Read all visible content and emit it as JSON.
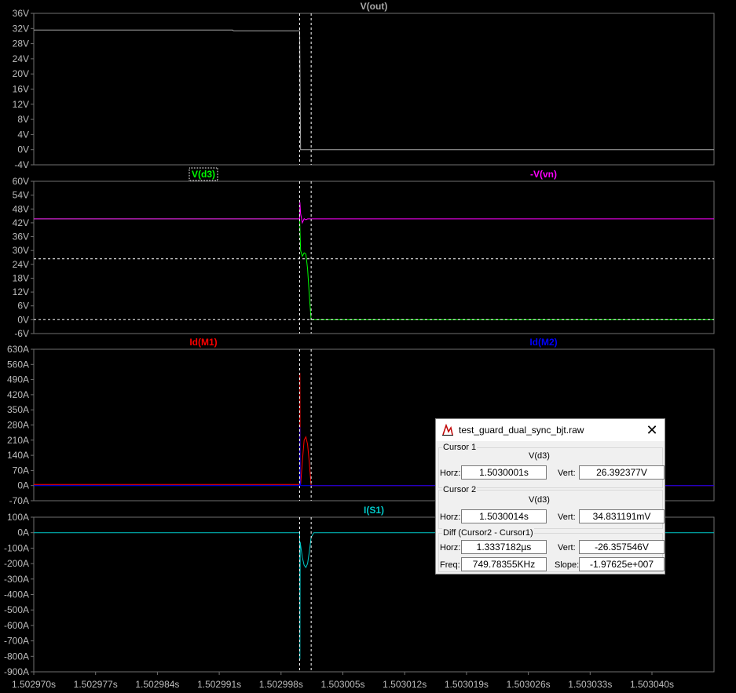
{
  "colors": {
    "background": "#000000",
    "grid": "#6f6f6f",
    "axis_text": "#bdbdbd",
    "cursor": "#ffffff",
    "vout": "#a9a9a9",
    "vd3": "#00ff00",
    "vn": "#ff00ff",
    "idm1": "#ff0000",
    "idm2": "#0000ff",
    "is1": "#00c8c8"
  },
  "x_axis": {
    "ticks": [
      "1.502970s",
      "1.502977s",
      "1.502984s",
      "1.502991s",
      "1.502998s",
      "1.503005s",
      "1.503012s",
      "1.503019s",
      "1.503026s",
      "1.503033s",
      "1.503040s"
    ]
  },
  "chart_data": [
    {
      "type": "line",
      "title": "V(out)",
      "yticks": [
        "36V",
        "32V",
        "28V",
        "24V",
        "20V",
        "16V",
        "12V",
        "8V",
        "4V",
        "0V",
        "-4V"
      ],
      "ylim": [
        -4,
        36
      ],
      "series": [
        {
          "name": "V(out)",
          "x": [
            1.50297,
            1.5029925,
            1.5029926,
            1.5030001,
            1.5030002,
            1.503047
          ],
          "y": [
            31.6,
            31.6,
            31.4,
            31.4,
            0.0,
            0.0
          ]
        }
      ]
    },
    {
      "type": "line",
      "title": "V(d3)",
      "title2": "-V(vn)",
      "yticks": [
        "60V",
        "54V",
        "48V",
        "42V",
        "36V",
        "30V",
        "24V",
        "18V",
        "12V",
        "6V",
        "0V",
        "-6V"
      ],
      "ylim": [
        -6,
        60
      ],
      "series": [
        {
          "name": "V(d3)",
          "x": [
            1.50297,
            1.5030001,
            1.50300012,
            1.5030002,
            1.5030004,
            1.5030006,
            1.5030008,
            1.503001,
            1.5030012,
            1.5030014,
            1.503047
          ],
          "y": [
            43.7,
            43.7,
            40,
            30,
            27.5,
            29,
            28.5,
            22,
            10,
            0.0,
            0.0
          ]
        },
        {
          "name": "-V(vn)",
          "x": [
            1.50297,
            1.5030001,
            1.50300012,
            1.5030002,
            1.5030004,
            1.5030006,
            1.5030008,
            1.503001,
            1.503047
          ],
          "y": [
            43.7,
            43.7,
            51,
            46,
            42,
            43.8,
            43.3,
            43.7,
            43.7
          ]
        }
      ]
    },
    {
      "type": "line",
      "title": "Id(M1)",
      "title2": "Id(M2)",
      "yticks": [
        "630A",
        "560A",
        "490A",
        "420A",
        "350A",
        "280A",
        "210A",
        "140A",
        "70A",
        "0A",
        "-70A"
      ],
      "ylim": [
        -70,
        630
      ],
      "series": [
        {
          "name": "Id(M1)",
          "x": [
            1.50297,
            1.5030001,
            1.50300012,
            1.50300016,
            1.5030002,
            1.5030004,
            1.5030006,
            1.5030008,
            1.503001,
            1.5030012,
            1.5030014,
            1.503047
          ],
          "y": [
            5,
            5,
            520,
            30,
            5,
            110,
            210,
            225,
            190,
            100,
            0,
            0
          ]
        },
        {
          "name": "Id(M2)",
          "x": [
            1.50297,
            1.5030001,
            1.50300012,
            1.50300016,
            1.5030002,
            1.503047
          ],
          "y": [
            0,
            0,
            270,
            20,
            0,
            0
          ]
        }
      ]
    },
    {
      "type": "line",
      "title": "I(S1)",
      "yticks": [
        "100A",
        "0A",
        "-100A",
        "-200A",
        "-300A",
        "-400A",
        "-500A",
        "-600A",
        "-700A",
        "-800A",
        "-900A"
      ],
      "ylim": [
        -900,
        100
      ],
      "series": [
        {
          "name": "I(S1)",
          "x": [
            1.50297,
            1.5030001,
            1.50300012,
            1.50300016,
            1.5030002,
            1.5030004,
            1.5030006,
            1.5030008,
            1.503001,
            1.5030012,
            1.5030014,
            1.5030017,
            1.503047
          ],
          "y": [
            0,
            0,
            -820,
            -60,
            -80,
            -160,
            -210,
            -225,
            -200,
            -120,
            -30,
            0,
            0
          ]
        }
      ]
    }
  ],
  "cursors": {
    "c1_x": 1.5030001,
    "c2_x": 1.5030014,
    "c1_y_pane2": 26.392377,
    "c2_y_pane2": 0.034831191
  },
  "dialog": {
    "title": "test_guard_dual_sync_bjt.raw",
    "close": "✕",
    "icon": "probe-icon",
    "cursor1": {
      "group": "Cursor 1",
      "trace": "V(d3)",
      "horz_label": "Horz:",
      "horz": "1.5030001s",
      "vert_label": "Vert:",
      "vert": "26.392377V"
    },
    "cursor2": {
      "group": "Cursor 2",
      "trace": "V(d3)",
      "horz_label": "Horz:",
      "horz": "1.5030014s",
      "vert_label": "Vert:",
      "vert": "34.831191mV"
    },
    "diff": {
      "group": "Diff (Cursor2 - Cursor1)",
      "horz_label": "Horz:",
      "horz": "1.3337182µs",
      "vert_label": "Vert:",
      "vert": "-26.357546V",
      "freq_label": "Freq:",
      "freq": "749.78355KHz",
      "slope_label": "Slope:",
      "slope": "-1.97625e+007"
    }
  }
}
